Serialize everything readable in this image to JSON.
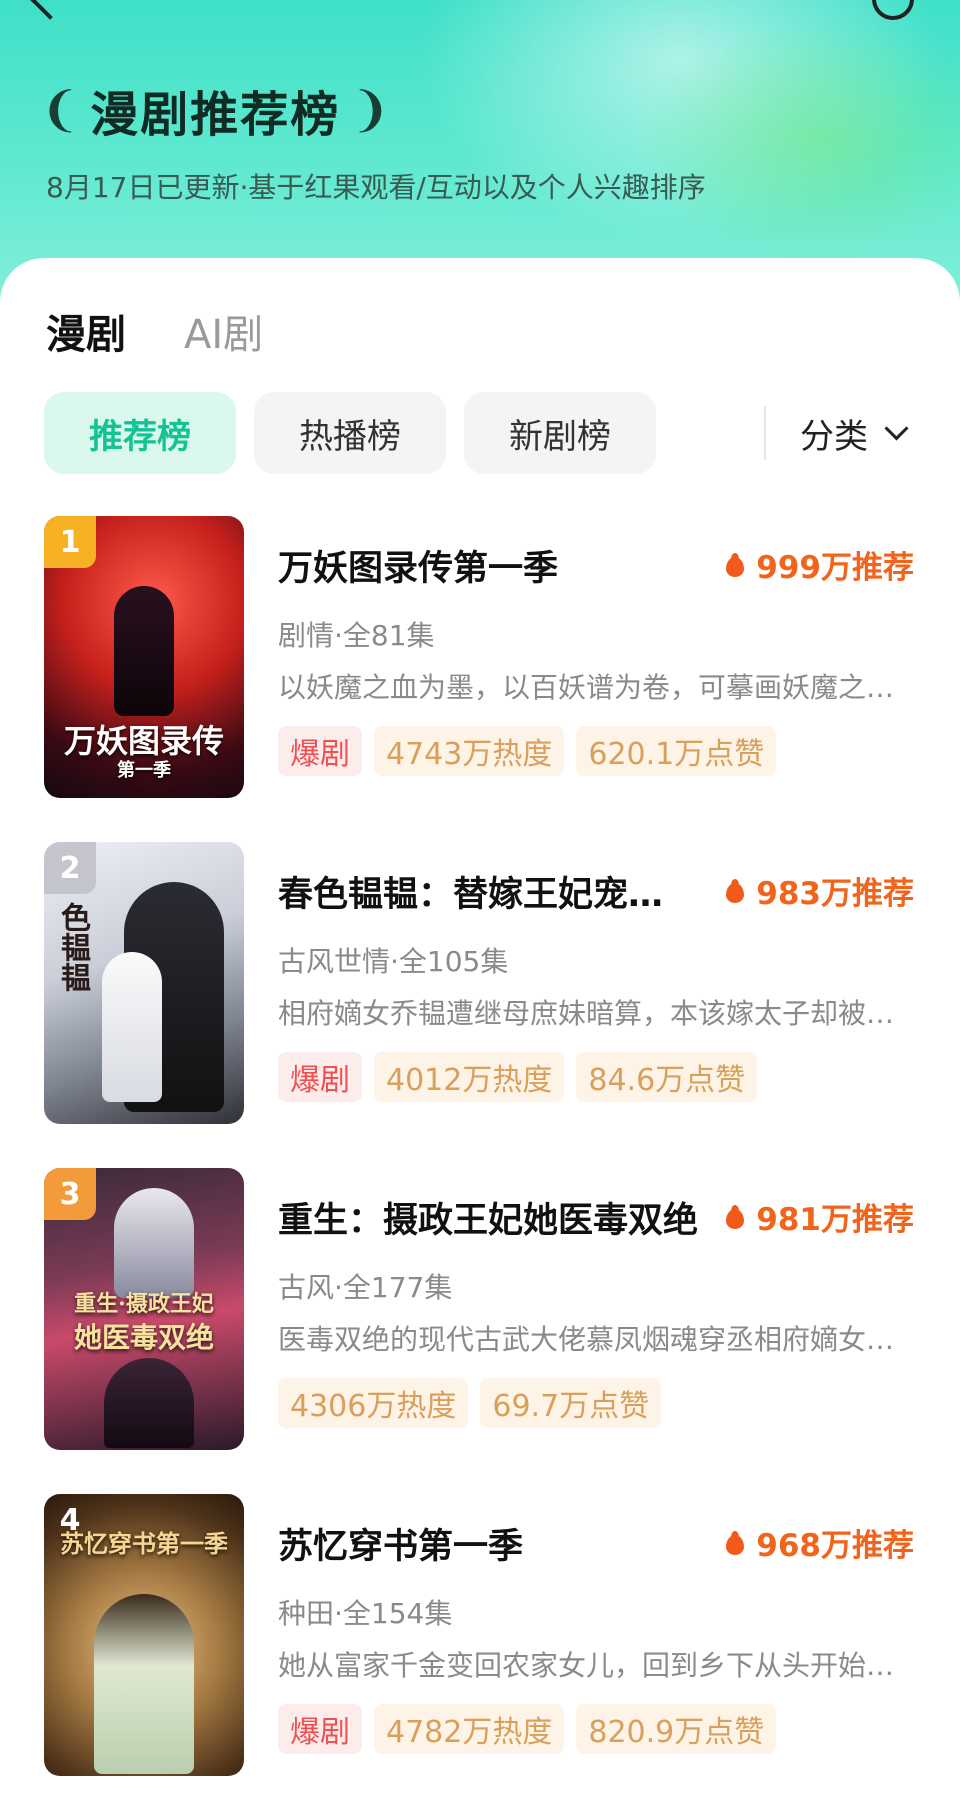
{
  "header": {
    "title": "漫剧推荐榜",
    "subtitle": "8月17日已更新·基于红果观看/互动以及个人兴趣排序"
  },
  "type_tabs": [
    {
      "label": "漫剧",
      "active": true
    },
    {
      "label": "AI剧",
      "active": false
    }
  ],
  "ranking_tabs": [
    {
      "label": "推荐榜",
      "active": true
    },
    {
      "label": "热播榜",
      "active": false
    },
    {
      "label": "新剧榜",
      "active": false
    }
  ],
  "filter": {
    "label": "分类"
  },
  "colors": {
    "accent": "#14c393",
    "recommend": "#f0641c",
    "hot_tag": "#f05050",
    "stat_tag": "#d9a05c"
  },
  "dramas": [
    {
      "rank": "1",
      "cover_text": "万妖图录传",
      "cover_sub": "第一季",
      "title": "万妖图录传第一季",
      "recommend": "999万推荐",
      "meta": "剧情·全81集",
      "desc": "以妖魔之血为墨，以百妖谱为卷，可摹画妖魔之力…",
      "tag": "爆剧",
      "heat": "4743万热度",
      "likes": "620.1万点赞"
    },
    {
      "rank": "2",
      "cover_text": "色韫韫",
      "title": "春色韫韫：替嫁王妃宠冠京华",
      "recommend": "983万推荐",
      "meta": "古风世情·全105集",
      "desc": "相府嫡女乔韫遭继母庶妹暗算，本该嫁太子却被迫…",
      "tag": "爆剧",
      "heat": "4012万热度",
      "likes": "84.6万点赞"
    },
    {
      "rank": "3",
      "cover_text": "重生·摄政王妃",
      "cover_sub": "她医毒双绝",
      "title": "重生：摄政王妃她医毒双绝",
      "recommend": "981万推荐",
      "meta": "古风·全177集",
      "desc": "医毒双绝的现代古武大佬慕凤烟魂穿丞相府嫡女…",
      "tag": "",
      "heat": "4306万热度",
      "likes": "69.7万点赞"
    },
    {
      "rank": "4",
      "cover_text": "苏忆穿书第一季",
      "title": "苏忆穿书第一季",
      "recommend": "968万推荐",
      "meta": "种田·全154集",
      "desc": "她从富家千金变回农家女儿，回到乡下从头开始…",
      "tag": "爆剧",
      "heat": "4782万热度",
      "likes": "820.9万点赞"
    }
  ]
}
